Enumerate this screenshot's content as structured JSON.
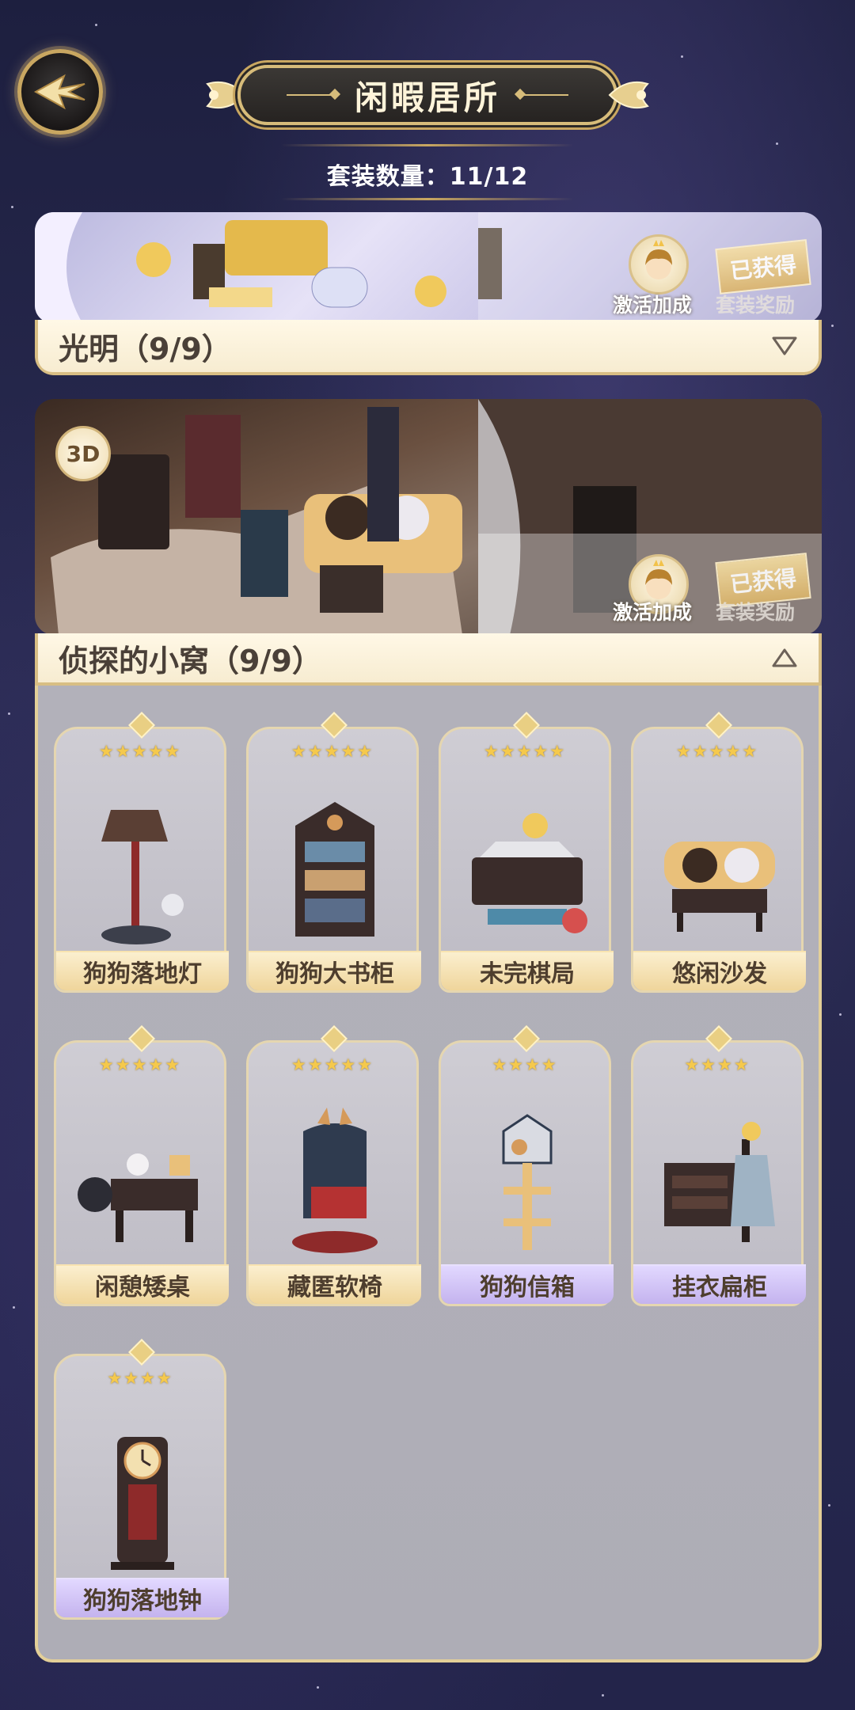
{
  "header": {
    "title": "闲暇居所",
    "suit_count": "套装数量：11/12"
  },
  "sets": [
    {
      "name": "光明（9/9）",
      "activate_label": "激活加成",
      "got_label": "已获得",
      "reward_label": "套装奖励",
      "expanded": false
    },
    {
      "name": "侦探的小窝（9/9）",
      "mode_badge": "3D",
      "activate_label": "激活加成",
      "got_label": "已获得",
      "reward_label": "套装奖励",
      "expanded": true
    }
  ],
  "items": [
    {
      "name": "狗狗落地灯",
      "stars": "★★★★★",
      "rarity": "gold"
    },
    {
      "name": "狗狗大书柜",
      "stars": "★★★★★",
      "rarity": "gold"
    },
    {
      "name": "未完棋局",
      "stars": "★★★★★",
      "rarity": "gold"
    },
    {
      "name": "悠闲沙发",
      "stars": "★★★★★",
      "rarity": "gold"
    },
    {
      "name": "闲憩矮桌",
      "stars": "★★★★★",
      "rarity": "gold"
    },
    {
      "name": "藏匿软椅",
      "stars": "★★★★★",
      "rarity": "gold"
    },
    {
      "name": "狗狗信箱",
      "stars": "★★★★",
      "rarity": "purple"
    },
    {
      "name": "挂衣扁柜",
      "stars": "★★★★",
      "rarity": "purple"
    },
    {
      "name": "狗狗落地钟",
      "stars": "★★★★",
      "rarity": "purple"
    }
  ],
  "colors": {
    "gold": "#d8be84",
    "purple": "#c4b3ee",
    "panel": "#b2b1ba"
  }
}
